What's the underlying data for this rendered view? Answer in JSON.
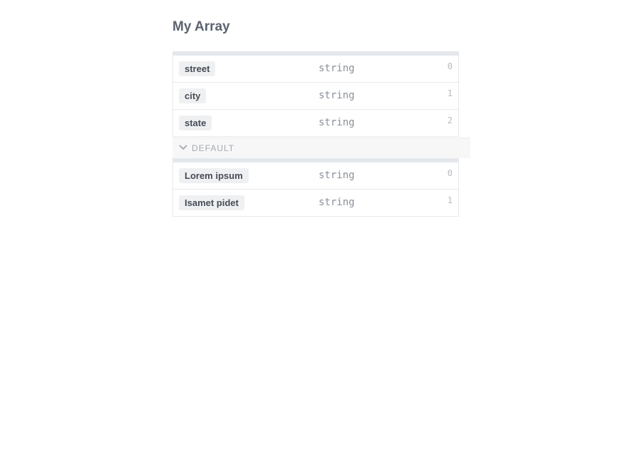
{
  "title": "My Array",
  "groups": [
    {
      "rows": [
        {
          "name": "street",
          "type": "string",
          "index": "0"
        },
        {
          "name": "city",
          "type": "string",
          "index": "1"
        },
        {
          "name": "state",
          "type": "string",
          "index": "2"
        }
      ]
    },
    {
      "rows": [
        {
          "name": "Lorem ipsum",
          "type": "string",
          "index": "0"
        },
        {
          "name": "Isamet pidet",
          "type": "string",
          "index": "1"
        }
      ]
    }
  ],
  "default_section": {
    "label": "DEFAULT",
    "icon": "chevron-down-icon"
  }
}
